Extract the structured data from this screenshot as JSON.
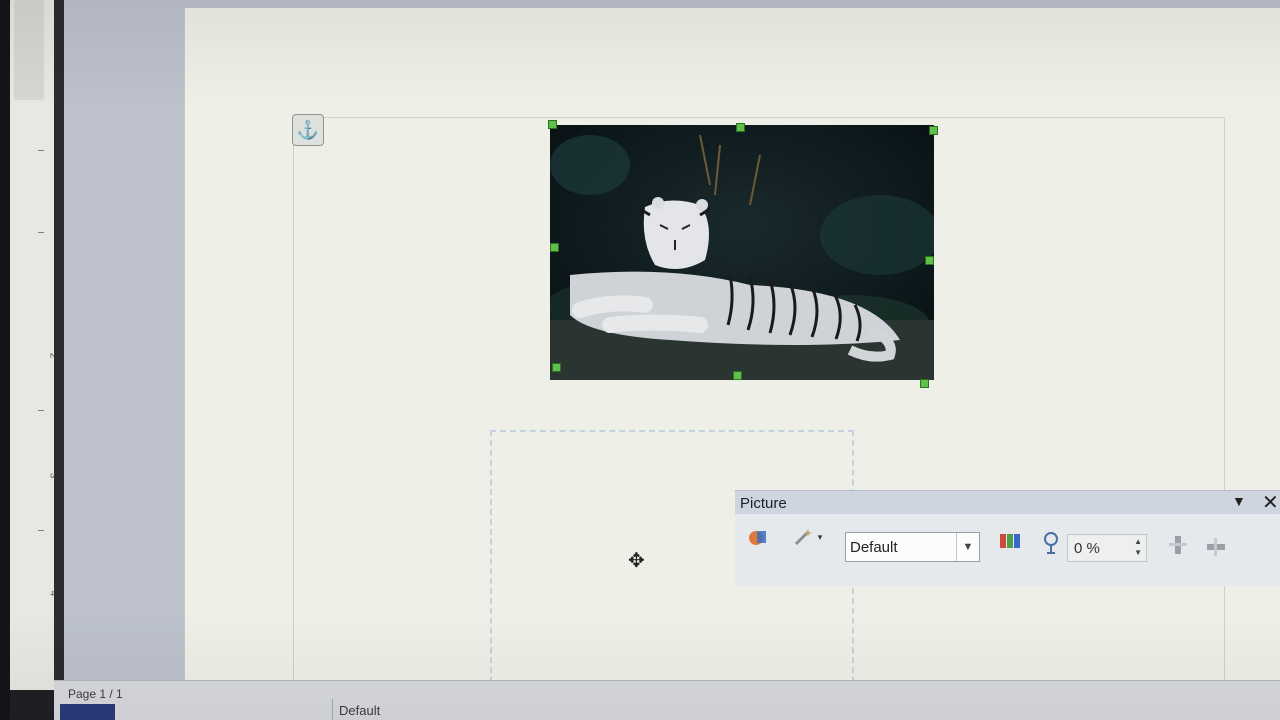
{
  "document": {
    "anchor_icon": "anchor-icon",
    "ruler_numbers": [
      "1",
      "2",
      "3",
      "4"
    ]
  },
  "picture_toolbar": {
    "title": "Picture",
    "mode_dropdown": {
      "value": "Default"
    },
    "transparency": {
      "value": "0 %"
    },
    "icons": [
      "filter-icon",
      "graphics-mode-icon",
      "color-icon",
      "transparency-icon",
      "flip-vertical-icon",
      "flip-horizontal-icon"
    ]
  },
  "status_bar": {
    "page": "Page 1 / 1",
    "page_style": "Default"
  },
  "colors": {
    "selection_handle": "#5ec14a",
    "page": "#eef0e8",
    "workspace": "#bcc1cc",
    "toolbar_title": "#cfd5e0"
  }
}
